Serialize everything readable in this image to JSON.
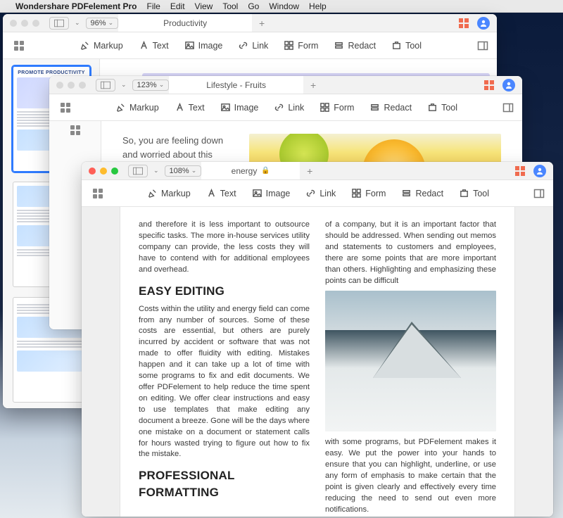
{
  "menubar": {
    "appname": "Wondershare PDFelement Pro",
    "items": [
      "File",
      "Edit",
      "View",
      "Tool",
      "Go",
      "Window",
      "Help"
    ]
  },
  "toolbar": {
    "markup": "Markup",
    "text": "Text",
    "image": "Image",
    "link": "Link",
    "form": "Form",
    "redact": "Redact",
    "tool": "Tool"
  },
  "win1": {
    "zoom": "96%",
    "tab": "Productivity",
    "thumb1_title": "PROMOTE PRODUCTIVITY"
  },
  "win2": {
    "zoom": "123%",
    "tab": "Lifestyle - Fruits",
    "text": "So, you are feeling down and worried about this"
  },
  "win3": {
    "zoom": "108%",
    "tab": "energy",
    "col1a": "and therefore it is less important to outsource specific tasks. The more in-house services utility company can provide, the less costs they will have to contend with for additional employees and overhead.",
    "h2a": "EASY EDITING",
    "col1b": "Costs within the utility and energy field can come from any number of sources. Some of these costs are essential, but others are purely incurred by accident or software that was not made to offer fluidity with editing. Mistakes happen and it can take up a lot of time with some programs to fix and edit documents. We offer PDFelement to help reduce the time spent on editing. We offer clear instructions and easy to use templates that make editing any document a breeze. Gone will be the days where one mistake on a document or statement calls for hours wasted trying to figure out how to fix the mistake.",
    "h2b": "PROFESSIONAL FORMATTING",
    "col2a": "of a company, but it is an important factor that should be addressed. When sending out memos and statements to customers and employees, there are some points that are more important than others. Highlighting and emphasizing these points can be difficult",
    "col2b": "with some programs, but PDFelement makes it easy. We put the power into your hands to ensure that you can highlight, underline, or use any form of emphasis to make certain that the point is given clearly and effectively every time reducing the need to send out even more notifications."
  }
}
